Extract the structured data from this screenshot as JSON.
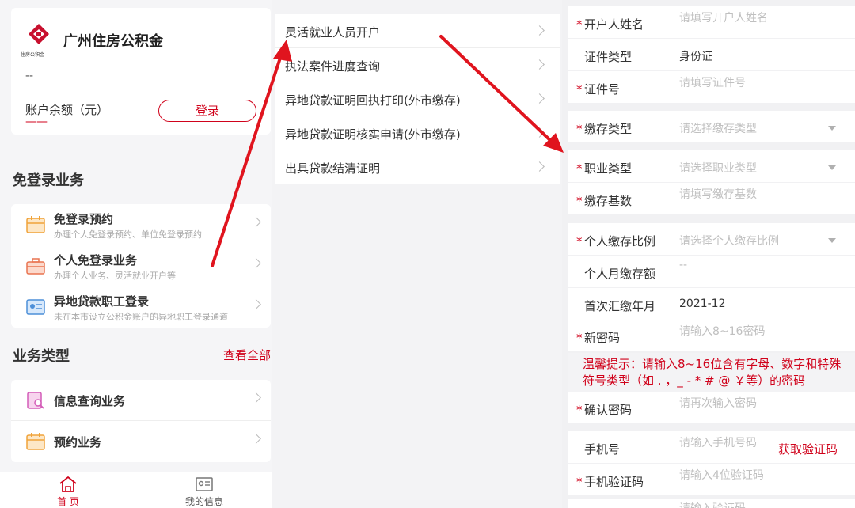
{
  "account": {
    "org_name": "广州住房公积金",
    "logo_small": "住房公积金",
    "dash": "--",
    "balance_label": "账户余额（元）",
    "balance_value": "——",
    "login_label": "登录"
  },
  "free_login": {
    "title": "免登录业务",
    "items": [
      {
        "title": "免登录预约",
        "sub": "办理个人免登录预约、单位免登录预约",
        "icon": "calendar-icon"
      },
      {
        "title": "个人免登录业务",
        "sub": "办理个人业务、灵活就业开户等",
        "icon": "briefcase-icon"
      },
      {
        "title": "异地贷款职工登录",
        "sub": "未在本市设立公积金账户的异地职工登录通道",
        "icon": "id-card-icon"
      }
    ]
  },
  "business": {
    "title": "业务类型",
    "view_all": "查看全部",
    "items": [
      {
        "title": "信息查询业务",
        "icon": "document-search-icon"
      },
      {
        "title": "预约业务",
        "icon": "calendar-icon"
      }
    ]
  },
  "tabbar": {
    "home": "首 页",
    "mine": "我的信息"
  },
  "menu": {
    "items": [
      "灵活就业人员开户",
      "执法案件进度查询",
      "异地贷款证明回执打印(外市缴存)",
      "异地贷款证明核实申请(外市缴存)",
      "出具贷款结清证明"
    ]
  },
  "form": {
    "name": {
      "label": "开户人姓名",
      "placeholder": "请填写开户人姓名"
    },
    "id_type": {
      "label": "证件类型",
      "value": "身份证"
    },
    "id_no": {
      "label": "证件号",
      "placeholder": "请填写证件号"
    },
    "deposit_type": {
      "label": "缴存类型",
      "placeholder": "请选择缴存类型"
    },
    "job_type": {
      "label": "职业类型",
      "placeholder": "请选择职业类型"
    },
    "deposit_base": {
      "label": "缴存基数",
      "placeholder": "请填写缴存基数"
    },
    "ratio": {
      "label": "个人缴存比例",
      "placeholder": "请选择个人缴存比例"
    },
    "monthly": {
      "label": "个人月缴存额",
      "value": "--"
    },
    "first_month": {
      "label": "首次汇缴年月",
      "value": "2021-12"
    },
    "new_pwd": {
      "label": "新密码",
      "placeholder": "请输入8~16密码"
    },
    "tip": "温馨提示：请输入8~16位含有字母、数字和特殊符号类型（如 . ，_ - * # @ ￥等）的密码",
    "confirm_pwd": {
      "label": "确认密码",
      "placeholder": "请再次输入密码"
    },
    "phone": {
      "label": "手机号",
      "placeholder": "请输入手机号码",
      "code_link": "获取验证码"
    },
    "sms_code": {
      "label": "手机验证码",
      "placeholder": "请输入4位验证码"
    },
    "captcha": {
      "placeholder": "请输入验证码"
    }
  },
  "colors": {
    "accent": "#d0021b",
    "annotation_arrow": "#e0141e"
  }
}
